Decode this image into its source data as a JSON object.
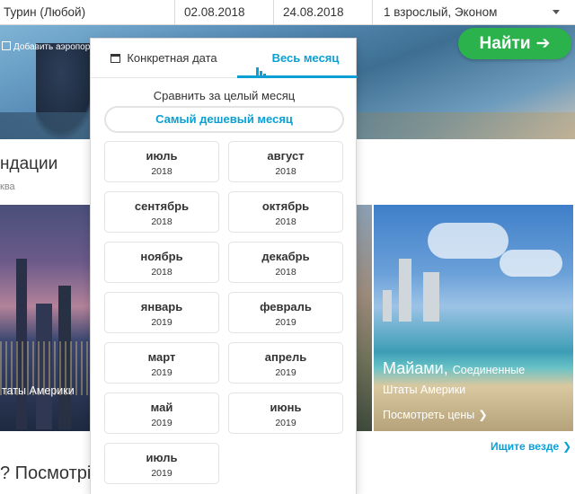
{
  "search": {
    "destination": "Турин (Любой)",
    "depart_date": "02.08.2018",
    "return_date": "24.08.2018",
    "passengers": "1 взрослый, Эконом"
  },
  "hero": {
    "add_airports": "Добавить аэропорт",
    "find_button": "Найти",
    "find_arrow": "➔"
  },
  "recommendations": {
    "title": "ндации",
    "subtitle": "ква"
  },
  "cards": {
    "left_label": "таты Америки",
    "miami_city": "Майами,",
    "miami_country_part1": "Соединенные",
    "miami_country_part2": "Штаты Америки",
    "miami_link": "Посмотреть цены",
    "miami_link_arrow": "❯"
  },
  "search_everywhere": {
    "label": "Ищите везде",
    "arrow": "❯"
  },
  "bottom_title": "? Посмотрі",
  "panel": {
    "tab_specific": "Конкретная дата",
    "tab_month": "Весь месяц",
    "compare_label": "Сравнить за целый месяц",
    "cheapest_button": "Самый дешевый месяц",
    "months": [
      {
        "month": "июль",
        "year": "2018"
      },
      {
        "month": "август",
        "year": "2018"
      },
      {
        "month": "сентябрь",
        "year": "2018"
      },
      {
        "month": "октябрь",
        "year": "2018"
      },
      {
        "month": "ноябрь",
        "year": "2018"
      },
      {
        "month": "декабрь",
        "year": "2018"
      },
      {
        "month": "январь",
        "year": "2019"
      },
      {
        "month": "февраль",
        "year": "2019"
      },
      {
        "month": "март",
        "year": "2019"
      },
      {
        "month": "апрель",
        "year": "2019"
      },
      {
        "month": "май",
        "year": "2019"
      },
      {
        "month": "июнь",
        "year": "2019"
      },
      {
        "month": "июль",
        "year": "2019"
      }
    ]
  },
  "colors": {
    "accent": "#0aa0d6",
    "find_button": "#2bb24c"
  }
}
